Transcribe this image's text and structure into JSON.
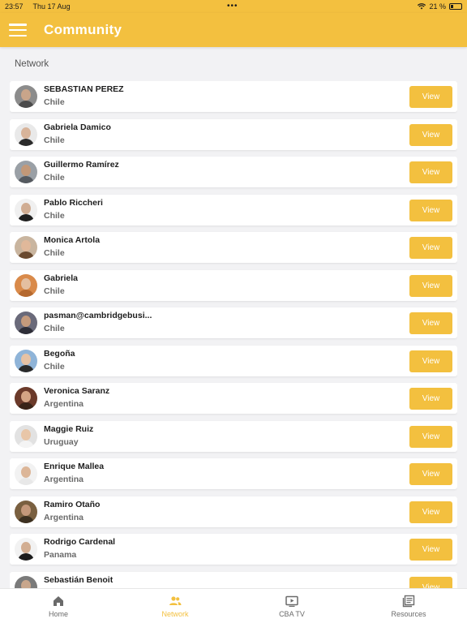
{
  "status_bar": {
    "time": "23:57",
    "date": "Thu 17 Aug",
    "battery": "21 %"
  },
  "header": {
    "title": "Community"
  },
  "section": {
    "label": "Network"
  },
  "members": [
    {
      "name": "SEBASTIAN PEREZ",
      "country": "Chile",
      "view_label": "View",
      "skin": "#c9a58a",
      "cloth": "#4b4b4b",
      "bg": "#8c8c8c"
    },
    {
      "name": "Gabriela Damico",
      "country": "Chile",
      "view_label": "View",
      "skin": "#d8b49a",
      "cloth": "#2b2b2b",
      "bg": "#e9e9e9"
    },
    {
      "name": "Guillermo Ramírez",
      "country": "Chile",
      "view_label": "View",
      "skin": "#c29878",
      "cloth": "#555a60",
      "bg": "#9aa0a6"
    },
    {
      "name": "Pablo Riccheri",
      "country": "Chile",
      "view_label": "View",
      "skin": "#d0ad93",
      "cloth": "#1f1f1f",
      "bg": "#f0f0f0"
    },
    {
      "name": "Monica Artola",
      "country": "Chile",
      "view_label": "View",
      "skin": "#e0b89a",
      "cloth": "#6a4a30",
      "bg": "#c9b59f"
    },
    {
      "name": "Gabriela",
      "country": "Chile",
      "view_label": "View",
      "skin": "#e4bfa0",
      "cloth": "#b5692f",
      "bg": "#d98a4a"
    },
    {
      "name": "pasman@cambridgebusi...",
      "country": "Chile",
      "view_label": "View",
      "skin": "#c49a7c",
      "cloth": "#2e2e38",
      "bg": "#6a6a7a"
    },
    {
      "name": "Begoña",
      "country": "Chile",
      "view_label": "View",
      "skin": "#e6c2a4",
      "cloth": "#2a2a2a",
      "bg": "#8fb4d8"
    },
    {
      "name": "Veronica Saranz",
      "country": "Argentina",
      "view_label": "View",
      "skin": "#d4a484",
      "cloth": "#3a2418",
      "bg": "#6b3a2a"
    },
    {
      "name": "Maggie Ruiz",
      "country": "Uruguay",
      "view_label": "View",
      "skin": "#e8c6a8",
      "cloth": "#f4f4f4",
      "bg": "#e2e2e2"
    },
    {
      "name": "Enrique Mallea",
      "country": "Argentina",
      "view_label": "View",
      "skin": "#dcb698",
      "cloth": "#e8e8e8",
      "bg": "#f2f2f2"
    },
    {
      "name": "Ramiro Otaño",
      "country": "Argentina",
      "view_label": "View",
      "skin": "#c4987a",
      "cloth": "#3c3020",
      "bg": "#7a6040"
    },
    {
      "name": "Rodrigo Cardenal",
      "country": "Panama",
      "view_label": "View",
      "skin": "#d2ae92",
      "cloth": "#1c1c1c",
      "bg": "#f2f2f2"
    },
    {
      "name": "Sebastián Benoit",
      "country": "",
      "view_label": "View",
      "skin": "#c8a68c",
      "cloth": "#3a3a3a",
      "bg": "#7a7a7a"
    }
  ],
  "tabs": [
    {
      "label": "Home",
      "icon": "home-icon",
      "active": false
    },
    {
      "label": "Network",
      "icon": "people-icon",
      "active": true
    },
    {
      "label": "CBA TV",
      "icon": "tv-icon",
      "active": false
    },
    {
      "label": "Resources",
      "icon": "resources-icon",
      "active": false
    }
  ],
  "colors": {
    "accent": "#f3c03f",
    "inactive": "#6a6a6a"
  }
}
